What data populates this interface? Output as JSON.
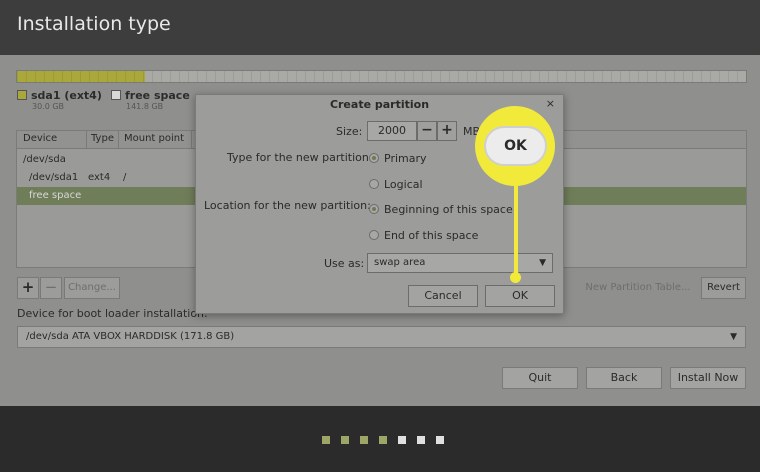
{
  "window": {
    "title": "Installation type"
  },
  "disk": {
    "legend": [
      {
        "name": "sda1 (ext4)",
        "size": "30.0 GB",
        "color": "#aaa83a"
      },
      {
        "name": "free space",
        "size": "141.8 GB",
        "color": "#ffffff"
      }
    ],
    "used_fraction": 0.175
  },
  "table": {
    "columns": [
      "Device",
      "Type",
      "Mount point"
    ],
    "rows": [
      {
        "device": "/dev/sda",
        "type": "",
        "mount": ""
      },
      {
        "device": "/dev/sda1",
        "type": "ext4",
        "mount": "/"
      },
      {
        "device": "free space",
        "type": "",
        "mount": "",
        "selected": true
      }
    ]
  },
  "table_buttons": {
    "add": "+",
    "remove": "−",
    "change": "Change...",
    "new_table": "New Partition Table...",
    "revert": "Revert"
  },
  "bootloader": {
    "label": "Device for boot loader installation:",
    "value": "/dev/sda   ATA VBOX HARDDISK (171.8 GB)"
  },
  "nav": {
    "quit": "Quit",
    "back": "Back",
    "install": "Install Now"
  },
  "progress": {
    "total_steps": 7,
    "completed_steps": 4,
    "done_color": "#9ea667",
    "todo_color": "#e0e0e0"
  },
  "dialog": {
    "title": "Create partition",
    "close": "×",
    "size_label": "Size:",
    "size_value": "2000",
    "size_unit": "MB",
    "minus": "−",
    "plus": "+",
    "type_label": "Type for the new partition:",
    "type_options": [
      "Primary",
      "Logical"
    ],
    "type_selected": "Primary",
    "location_label": "Location for the new partition:",
    "location_options": [
      "Beginning of this space",
      "End of this space"
    ],
    "location_selected": "Beginning of this space",
    "use_as_label": "Use as:",
    "use_as_value": "swap area",
    "cancel": "Cancel",
    "ok": "OK"
  },
  "callout": {
    "label": "OK",
    "color": "#f2ea3b"
  }
}
